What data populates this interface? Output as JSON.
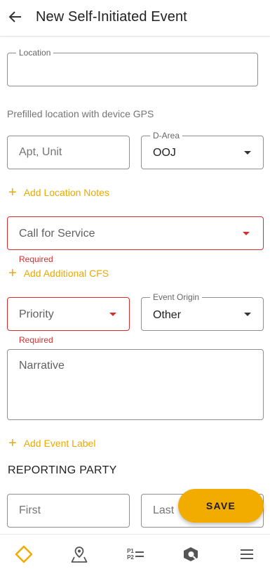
{
  "header": {
    "title": "New Self-Initiated Event",
    "back_icon": "arrow-left-icon"
  },
  "location": {
    "label": "Location",
    "value": "",
    "helper": "Prefilled location with device GPS"
  },
  "apt_unit": {
    "placeholder": "Apt, Unit"
  },
  "d_area": {
    "label": "D-Area",
    "value": "OOJ"
  },
  "add_location_notes": "Add Location Notes",
  "call_for_service": {
    "placeholder": "Call for Service",
    "error": "Required"
  },
  "add_additional_cfs": "Add Additional CFS",
  "priority": {
    "placeholder": "Priority",
    "error": "Required"
  },
  "event_origin": {
    "label": "Event Origin",
    "value": "Other"
  },
  "narrative": {
    "placeholder": "Narrative"
  },
  "add_event_label": "Add Event Label",
  "reporting_party": {
    "title": "REPORTING PARTY",
    "first_placeholder": "First",
    "last_placeholder": "Last"
  },
  "save_label": "SAVE",
  "bottom_nav": {
    "items": [
      "diamond-icon",
      "map-pin-icon",
      "priority-list-icon",
      "search-icon",
      "menu-icon"
    ],
    "priority_top": "P1",
    "priority_bottom": "P2"
  },
  "colors": {
    "accent": "#f2ac00",
    "link": "#eba900",
    "error": "#d32f2f"
  }
}
